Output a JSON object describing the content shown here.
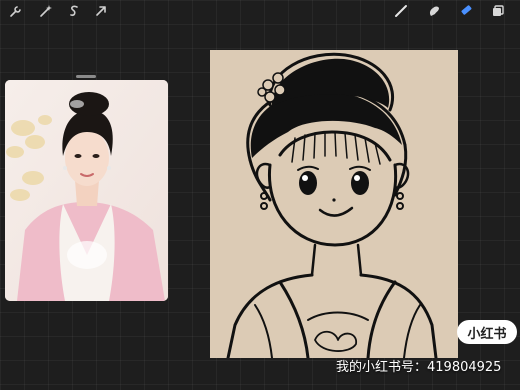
{
  "toolbar": {
    "left_tools": [
      {
        "name": "wrench-icon"
      },
      {
        "name": "magic-wand-icon"
      },
      {
        "name": "selection-icon"
      },
      {
        "name": "transform-arrow-icon"
      }
    ],
    "right_tools": [
      {
        "name": "brush-icon"
      },
      {
        "name": "smudge-icon"
      },
      {
        "name": "eraser-icon",
        "active": true
      },
      {
        "name": "layers-icon"
      }
    ],
    "active_color": "#4a90ff"
  },
  "reference": {
    "content": "photo of woman in pink hanfu with floral background"
  },
  "canvas": {
    "background": "#dccbb5",
    "content": "black line-art cartoon girl with bun hairstyle"
  },
  "watermark": {
    "badge_label": "小红书",
    "id_text": "我的小红书号：419804925"
  }
}
